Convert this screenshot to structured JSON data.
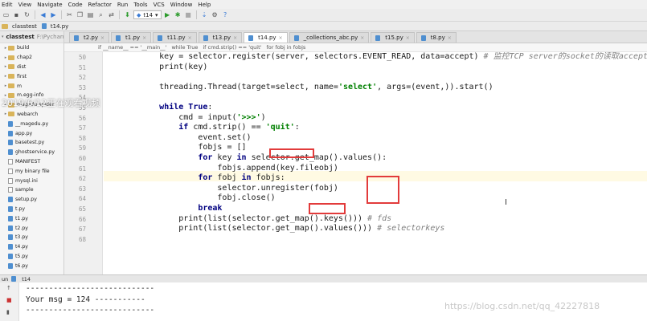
{
  "menu": [
    "Edit",
    "View",
    "Navigate",
    "Code",
    "Refactor",
    "Run",
    "Tools",
    "VCS",
    "Window",
    "Help"
  ],
  "toolbar": {
    "run_config": "t14"
  },
  "nav": {
    "project": "classtest",
    "file": "t14.py"
  },
  "project_panel": {
    "title": "classtest",
    "path": "F:\\Pycharm",
    "items": [
      {
        "label": "build",
        "kind": "folder",
        "arrow": "▸"
      },
      {
        "label": "chap2",
        "kind": "folder",
        "arrow": "▸"
      },
      {
        "label": "dist",
        "kind": "folder",
        "arrow": "▸"
      },
      {
        "label": "first",
        "kind": "folder",
        "arrow": "▸"
      },
      {
        "label": "m",
        "kind": "folder",
        "arrow": "▸"
      },
      {
        "label": "m.egg-info",
        "kind": "folder",
        "arrow": "▸"
      },
      {
        "label": "magedu.spider",
        "kind": "folder",
        "arrow": "▸"
      },
      {
        "label": "webarch",
        "kind": "folder",
        "arrow": "▸"
      },
      {
        "label": "__magedu.py",
        "kind": "py",
        "arrow": ""
      },
      {
        "label": "app.py",
        "kind": "py",
        "arrow": ""
      },
      {
        "label": "basetest.py",
        "kind": "py",
        "arrow": ""
      },
      {
        "label": "ghostservice.py",
        "kind": "py",
        "arrow": ""
      },
      {
        "label": "MANIFEST",
        "kind": "txt",
        "arrow": ""
      },
      {
        "label": "my binary file",
        "kind": "txt",
        "arrow": ""
      },
      {
        "label": "mysql.ini",
        "kind": "txt",
        "arrow": ""
      },
      {
        "label": "sample",
        "kind": "txt",
        "arrow": ""
      },
      {
        "label": "setup.py",
        "kind": "py",
        "arrow": ""
      },
      {
        "label": "t.py",
        "kind": "py",
        "arrow": ""
      },
      {
        "label": "t1.py",
        "kind": "py",
        "arrow": ""
      },
      {
        "label": "t2.py",
        "kind": "py",
        "arrow": ""
      },
      {
        "label": "t3.py",
        "kind": "py",
        "arrow": ""
      },
      {
        "label": "t4.py",
        "kind": "py",
        "arrow": ""
      },
      {
        "label": "t5.py",
        "kind": "py",
        "arrow": ""
      },
      {
        "label": "t6.py",
        "kind": "py",
        "arrow": ""
      }
    ]
  },
  "tabs": [
    {
      "label": "t2.py",
      "active": false
    },
    {
      "label": "t1.py",
      "active": false
    },
    {
      "label": "t11.py",
      "active": false
    },
    {
      "label": "t13.py",
      "active": false
    },
    {
      "label": "t14.py",
      "active": true
    },
    {
      "label": "_collections_abc.py",
      "active": false
    },
    {
      "label": "t15.py",
      "active": false
    },
    {
      "label": "t8.py",
      "active": false
    }
  ],
  "breadcrumb": [
    "if __name__ == '__main__'",
    "while True",
    "if cmd.strip() == 'quit'",
    "for fobj in fobjs"
  ],
  "code": {
    "line_numbers": [
      "50",
      "51",
      "52",
      "53",
      "54",
      "55",
      "56",
      "57",
      "58",
      "59",
      "60",
      "61",
      "62",
      "63",
      "64",
      "65",
      "66",
      "67",
      "68"
    ],
    "lines": [
      [
        {
          "t": "        key = selector.register(server, selectors.EVENT_READ, data=accept) ",
          "c": ""
        },
        {
          "t": "# 监控TCP server的socket的读取accept",
          "c": "cmt"
        }
      ],
      [
        {
          "t": "        print(key)",
          "c": ""
        }
      ],
      [
        {
          "t": "",
          "c": ""
        }
      ],
      [
        {
          "t": "        threading.Thread(target=select, name=",
          "c": ""
        },
        {
          "t": "'select'",
          "c": "str"
        },
        {
          "t": ", args=(event,)).start()",
          "c": ""
        }
      ],
      [
        {
          "t": "",
          "c": ""
        }
      ],
      [
        {
          "t": "        ",
          "c": ""
        },
        {
          "t": "while True",
          "c": "kw"
        },
        {
          "t": ":",
          "c": ""
        }
      ],
      [
        {
          "t": "            cmd = input(",
          "c": ""
        },
        {
          "t": "'>>>'",
          "c": "str"
        },
        {
          "t": ")",
          "c": ""
        }
      ],
      [
        {
          "t": "            ",
          "c": ""
        },
        {
          "t": "if",
          "c": "kw"
        },
        {
          "t": " cmd.strip() == ",
          "c": ""
        },
        {
          "t": "'quit'",
          "c": "str"
        },
        {
          "t": ":",
          "c": ""
        }
      ],
      [
        {
          "t": "                event.set()",
          "c": ""
        }
      ],
      [
        {
          "t": "                fobjs = []",
          "c": ""
        }
      ],
      [
        {
          "t": "                ",
          "c": ""
        },
        {
          "t": "for",
          "c": "kw"
        },
        {
          "t": " key ",
          "c": ""
        },
        {
          "t": "in",
          "c": "kw"
        },
        {
          "t": " selector.get_map().values():",
          "c": ""
        }
      ],
      [
        {
          "t": "                    fobjs.append(key.fileobj)",
          "c": ""
        }
      ],
      [
        {
          "t": "                ",
          "c": ""
        },
        {
          "t": "for",
          "c": "kw"
        },
        {
          "t": " fobj ",
          "c": ""
        },
        {
          "t": "in",
          "c": "kw"
        },
        {
          "t": " fobjs:",
          "c": ""
        }
      ],
      [
        {
          "t": "                    selector.unregister(fobj)",
          "c": ""
        }
      ],
      [
        {
          "t": "                    fobj.close()",
          "c": ""
        }
      ],
      [
        {
          "t": "                ",
          "c": ""
        },
        {
          "t": "break",
          "c": "kw"
        }
      ],
      [
        {
          "t": "            print(list(selector.get_map().keys())) ",
          "c": ""
        },
        {
          "t": "# fds",
          "c": "cmt"
        }
      ],
      [
        {
          "t": "            print(list(selector.get_map().values())) ",
          "c": ""
        },
        {
          "t": "# selectorkeys",
          "c": "cmt"
        }
      ],
      [
        {
          "t": "",
          "c": ""
        }
      ]
    ]
  },
  "overlay_watermark": "2019/6/12正在观看视频",
  "run_panel": {
    "label": "un",
    "config": "t14"
  },
  "console": {
    "lines": [
      "----------------------------",
      "Your msg = 124 -----------",
      "----------------------------"
    ]
  },
  "site_watermark": "https://blog.csdn.net/qq_42227818"
}
